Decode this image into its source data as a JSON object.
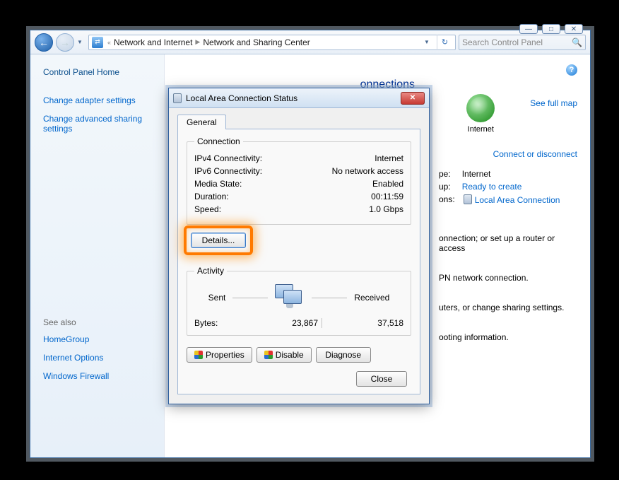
{
  "outer": {
    "caption_min": "—",
    "caption_max": "□",
    "caption_close": "✕",
    "breadcrumb": {
      "level1": "Network and Internet",
      "level2": "Network and Sharing Center"
    },
    "search_placeholder": "Search Control Panel"
  },
  "sidebar": {
    "home": "Control Panel Home",
    "links": [
      "Change adapter settings",
      "Change advanced sharing settings"
    ],
    "seealso_hdr": "See also",
    "seealso": [
      "HomeGroup",
      "Internet Options",
      "Windows Firewall"
    ]
  },
  "main": {
    "title_visible_suffix": "onnections",
    "see_full_map": "See full map",
    "internet_label": "Internet",
    "connect_link": "Connect or disconnect",
    "info": {
      "type_lbl_suffix": "pe:",
      "type_val": "Internet",
      "group_lbl_suffix": "up:",
      "group_val": "Ready to create",
      "conn_lbl_suffix": "ons:",
      "conn_val": "Local Area Connection"
    },
    "body_lines": [
      "onnection; or set up a router or access",
      "PN network connection.",
      "uters, or change sharing settings.",
      "ooting information."
    ]
  },
  "dialog": {
    "title": "Local Area Connection Status",
    "tab": "General",
    "group_conn": "Connection",
    "group_act": "Activity",
    "conn": {
      "ipv4_l": "IPv4 Connectivity:",
      "ipv4_v": "Internet",
      "ipv6_l": "IPv6 Connectivity:",
      "ipv6_v": "No network access",
      "media_l": "Media State:",
      "media_v": "Enabled",
      "dur_l": "Duration:",
      "dur_v": "00:11:59",
      "speed_l": "Speed:",
      "speed_v": "1.0 Gbps"
    },
    "details_btn": "Details...",
    "act": {
      "sent_l": "Sent",
      "recv_l": "Received",
      "bytes_l": "Bytes:",
      "sent_v": "23,867",
      "recv_v": "37,518"
    },
    "btns": {
      "properties": "Properties",
      "disable": "Disable",
      "diagnose": "Diagnose",
      "close": "Close"
    }
  }
}
